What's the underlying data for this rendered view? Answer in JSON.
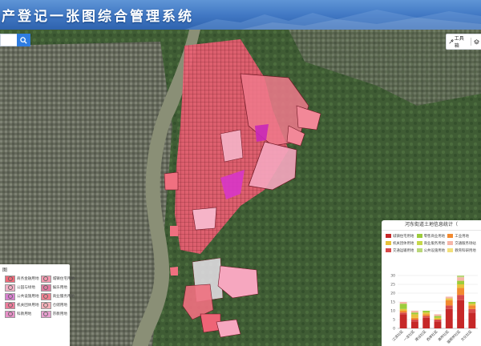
{
  "app": {
    "title": "产登记一张图综合管理系统"
  },
  "search": {
    "placeholder": "",
    "button_icon": "search-icon"
  },
  "toolbar": {
    "items": [
      {
        "icon": "tools-icon",
        "label": "工具箱"
      },
      {
        "icon": "layers-icon",
        "label": ""
      }
    ]
  },
  "legend": {
    "title": "图",
    "items": [
      {
        "label": "商务金融用地",
        "color": "#f06878"
      },
      {
        "label": "城镇住宅用地",
        "color": "#f59ab0"
      },
      {
        "label": "公园与绿地",
        "color": "#f3b0c6"
      },
      {
        "label": "娱乐用地",
        "color": "#e07ba0"
      },
      {
        "label": "公共设施用地",
        "color": "#d77fcf"
      },
      {
        "label": "商业服务用地",
        "color": "#f08090"
      },
      {
        "label": "机关团体用地",
        "color": "#ee7c9b"
      },
      {
        "label": "仓储用地",
        "color": "#f4b0b8"
      },
      {
        "label": "科教用地",
        "color": "#e890c8"
      },
      {
        "label": "宗教用地",
        "color": "#e8a0d0"
      }
    ]
  },
  "stats": {
    "title": "河东街道土地信息统计（",
    "legend": [
      {
        "label": "城镇住宅用地",
        "color": "#c62828"
      },
      {
        "label": "零售商业用地",
        "color": "#9ccc3b"
      },
      {
        "label": "工业用地",
        "color": "#f28a30"
      },
      {
        "label": "机关团体用地",
        "color": "#e8c23a"
      },
      {
        "label": "商业服务用地",
        "color": "#c6d84a"
      },
      {
        "label": "交通服务场站",
        "color": "#f6b6a8"
      },
      {
        "label": "交通运输用地",
        "color": "#d84a4a"
      },
      {
        "label": "公共设施用地",
        "color": "#b9d77a"
      },
      {
        "label": "教育科研用地",
        "color": "#f3e07a"
      }
    ]
  },
  "chart_data": {
    "type": "bar",
    "stacked": true,
    "title": "河东街道土地信息统计（",
    "categories": [
      "江滨社区",
      "一龙社区",
      "建设社区",
      "西岸社区",
      "高桥社区",
      "猫眼桥社区",
      "文化社区"
    ],
    "ylim": [
      0,
      30
    ],
    "yticks": [
      0,
      5,
      10,
      15,
      20,
      25,
      30
    ],
    "series": [
      {
        "name": "城镇住宅用地",
        "color": "#c62828",
        "values": [
          8,
          4,
          6,
          4,
          11,
          16,
          9
        ]
      },
      {
        "name": "交通运输用地",
        "color": "#d84a4a",
        "values": [
          1,
          1,
          1,
          1,
          2,
          3,
          2
        ]
      },
      {
        "name": "工业用地",
        "color": "#f28a30",
        "values": [
          1,
          1,
          1,
          0,
          3,
          4,
          2
        ]
      },
      {
        "name": "机关团体用地",
        "color": "#e8c23a",
        "values": [
          1,
          2,
          1,
          1,
          1,
          2,
          1
        ]
      },
      {
        "name": "零售商业用地",
        "color": "#9ccc3b",
        "values": [
          3,
          1,
          1,
          1,
          0,
          2,
          1
        ]
      },
      {
        "name": "交通服务场站",
        "color": "#f6b6a8",
        "values": [
          1,
          1,
          0,
          1,
          1,
          2,
          0
        ]
      },
      {
        "name": "公共设施用地",
        "color": "#b9d77a",
        "values": [
          0,
          0,
          0,
          0,
          0,
          1,
          0
        ]
      }
    ]
  }
}
